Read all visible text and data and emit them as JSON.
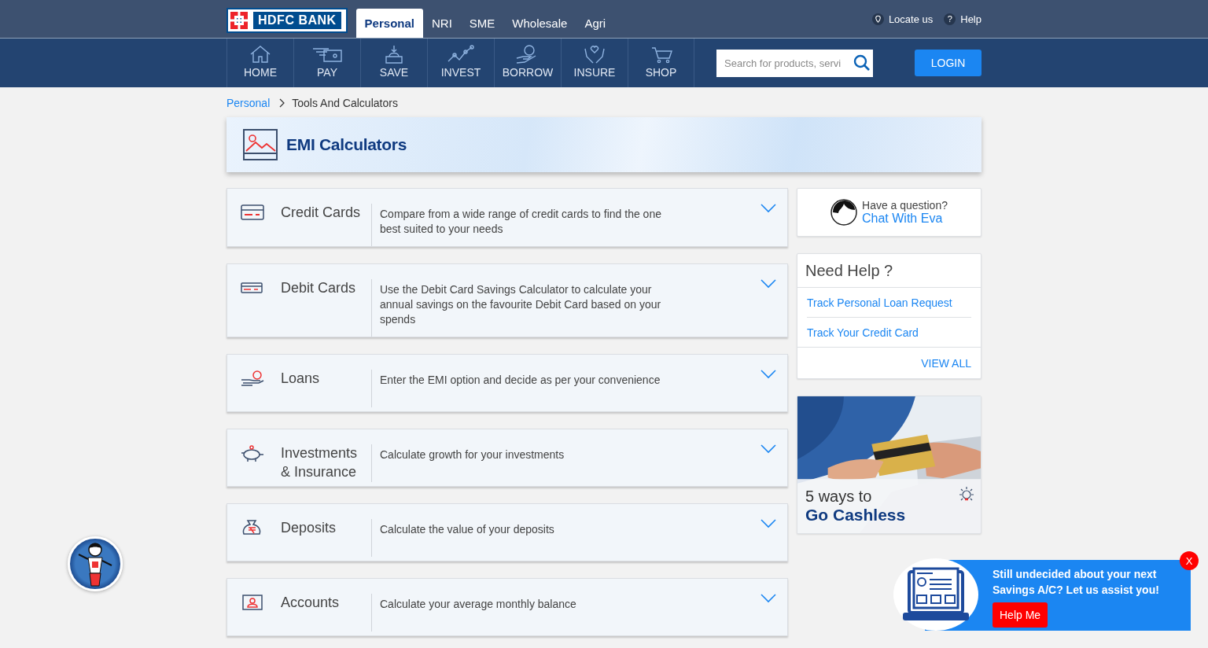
{
  "header": {
    "logo": "HDFC BANK",
    "tabs": [
      {
        "label": "Personal",
        "selected": true
      },
      {
        "label": "NRI",
        "selected": false
      },
      {
        "label": "SME",
        "selected": false
      },
      {
        "label": "Wholesale",
        "selected": false
      },
      {
        "label": "Agri",
        "selected": false
      }
    ],
    "links": [
      {
        "kind": "pin",
        "label": "Locate us"
      },
      {
        "kind": "help",
        "icon": "?",
        "label": "Help"
      }
    ]
  },
  "nav": {
    "items": [
      {
        "kind": "home",
        "label": "HOME"
      },
      {
        "kind": "pay",
        "label": "PAY"
      },
      {
        "kind": "save",
        "label": "SAVE"
      },
      {
        "kind": "invest",
        "label": "INVEST"
      },
      {
        "kind": "borrow",
        "label": "BORROW"
      },
      {
        "kind": "insure",
        "label": "INSURE"
      },
      {
        "kind": "shop",
        "label": "SHOP"
      }
    ],
    "search": {
      "placeholder": "Search for products, servi"
    },
    "login": "LOGIN"
  },
  "breadcrumb": [
    {
      "label": "Personal",
      "link": true
    },
    {
      "label": "Tools And Calculators",
      "link": false
    }
  ],
  "banner": {
    "title": "EMI Calculators"
  },
  "categories": [
    {
      "kind": "credit",
      "title": "Credit Cards",
      "description": "Compare from a wide range of credit cards to find the one best suited to your needs"
    },
    {
      "kind": "debit",
      "title": "Debit Cards",
      "description": "Use the Debit Card Savings Calculator to calculate your annual savings on the favourite Debit Card based on your spends"
    },
    {
      "kind": "loan",
      "title": "Loans",
      "description": "Enter the EMI option and decide as per your convenience"
    },
    {
      "kind": "invest",
      "title": "Investments & Insurance",
      "description": "Calculate growth for your investments"
    },
    {
      "kind": "deposit",
      "title": "Deposits",
      "description": "Calculate the value of your deposits"
    },
    {
      "kind": "account",
      "title": "Accounts",
      "description": "Calculate your average monthly balance"
    }
  ],
  "chat": {
    "question": "Have a question?",
    "link": "Chat With Eva"
  },
  "help": {
    "title": "Need Help ?",
    "links": [
      "Track Personal Loan Request",
      "Track Your Credit Card"
    ],
    "view_all": "VIEW ALL"
  },
  "promo": {
    "line1": "5 ways to",
    "line2": "Go Cashless"
  },
  "popup": {
    "message": "Still undecided about your next Savings A/C? Let us assist you!",
    "button": "Help Me",
    "close": "X"
  }
}
